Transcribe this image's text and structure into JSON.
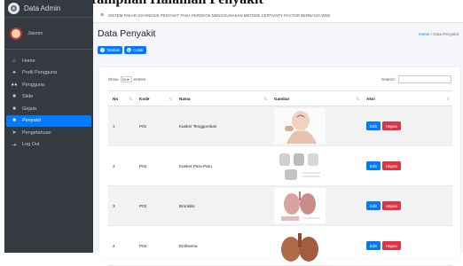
{
  "page_heading": "Tampilan Halaman Penyakit",
  "brand": {
    "name": "Data Admin"
  },
  "user": {
    "name": "Jasmin"
  },
  "sidebar": {
    "items": [
      {
        "label": "Home",
        "icon": "home-icon"
      },
      {
        "label": "Profil Pengguna",
        "icon": "user-icon"
      },
      {
        "label": "Pengguna",
        "icon": "users-icon"
      },
      {
        "label": "Slide",
        "icon": "book-icon"
      },
      {
        "label": "Gejala",
        "icon": "book-icon"
      },
      {
        "label": "Penyakit",
        "icon": "book-icon",
        "active": true
      },
      {
        "label": "Pengetahuan",
        "icon": "paper-plane-icon"
      },
      {
        "label": "Log Out",
        "icon": "sign-out-icon"
      }
    ]
  },
  "topbar": {
    "title": "SISTEM PAKAR DIAGNOSIS PENYAKIT PADA PEROKOK MENGGUNAKAN METODE CERTAINTY FACTOR BERBASIS WEB"
  },
  "content": {
    "title": "Data Penyakit",
    "breadcrumb": {
      "home": "Home",
      "separator": "/",
      "current": "Data Penyakit"
    },
    "buttons": {
      "add": "Tambah",
      "print": "Cetak"
    }
  },
  "table_tools": {
    "show_label": "Show",
    "entries_value": "10",
    "entries_label": "entries",
    "search_label": "Search:"
  },
  "table": {
    "headers": [
      "No",
      "Kode",
      "Nama",
      "Gambar",
      "Aksi"
    ],
    "rows": [
      {
        "no": "1",
        "kode": "P01",
        "nama": "Kanker Tenggorokan",
        "edit": "Edit",
        "hapus": "Hapus"
      },
      {
        "no": "2",
        "kode": "P02",
        "nama": "Kanker Paru-Paru",
        "edit": "Edit",
        "hapus": "Hapus"
      },
      {
        "no": "3",
        "kode": "P03",
        "nama": "Bronkitis",
        "edit": "Edit",
        "hapus": "Hapus"
      },
      {
        "no": "4",
        "kode": "P04",
        "nama": "Emfisema",
        "edit": "Edit",
        "hapus": "Hapus"
      }
    ]
  },
  "colors": {
    "sidebar": "#343a40",
    "accent": "#007bff",
    "danger": "#dc3545",
    "content_bg": "#f4f6f9"
  }
}
